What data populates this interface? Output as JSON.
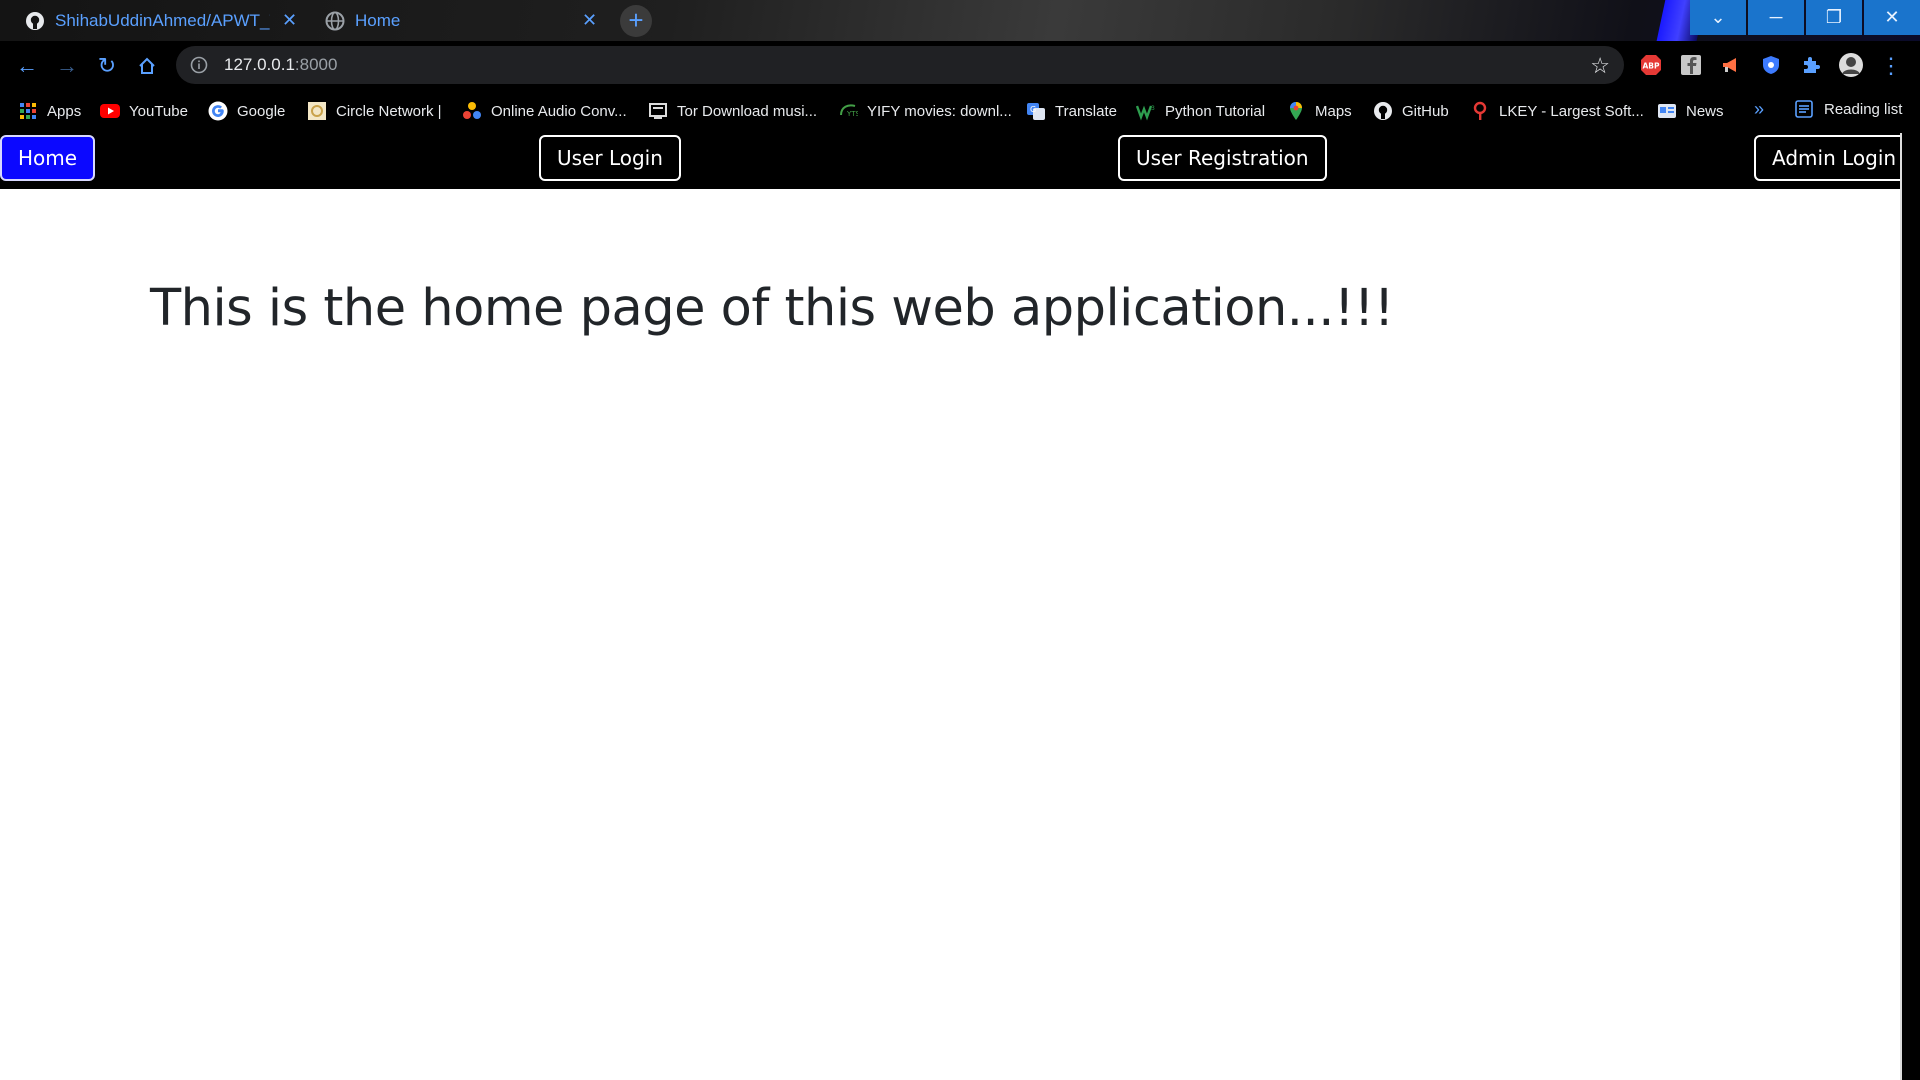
{
  "browser": {
    "tabs": [
      {
        "title": "ShihabUddinAhmed/APWT_TASK",
        "icon": "github-icon"
      },
      {
        "title": "Home",
        "icon": "globe-icon"
      }
    ],
    "address": {
      "host": "127.0.0.1",
      "port": ":8000"
    },
    "bookmarks": [
      {
        "label": "Apps",
        "icon": "apps-grid-icon"
      },
      {
        "label": "YouTube",
        "icon": "youtube-icon"
      },
      {
        "label": "Google",
        "icon": "google-icon"
      },
      {
        "label": "Circle Network |",
        "icon": "circle-network-icon"
      },
      {
        "label": "Online Audio Conv...",
        "icon": "audio-converter-icon"
      },
      {
        "label": "Tor Download musi...",
        "icon": "tor-icon"
      },
      {
        "label": "YIFY movies: downl...",
        "icon": "yify-icon"
      },
      {
        "label": "Translate",
        "icon": "translate-icon"
      },
      {
        "label": "Python Tutorial",
        "icon": "w3schools-icon"
      },
      {
        "label": "Maps",
        "icon": "maps-pin-icon"
      },
      {
        "label": "GitHub",
        "icon": "github-icon"
      },
      {
        "label": "LKEY - Largest Soft...",
        "icon": "lkey-icon"
      },
      {
        "label": "News",
        "icon": "news-icon"
      }
    ],
    "more_bookmarks": "»",
    "reading_list": "Reading list",
    "colors": {
      "accent": "#5aa0ff",
      "window_controls": "#1a74cc"
    }
  },
  "page": {
    "nav": {
      "home": "Home",
      "user_login": "User Login",
      "user_registration": "User Registration",
      "admin_login": "Admin Login"
    },
    "heading": "This is the home page of this web application...!!!",
    "colors": {
      "navbar": "#000000",
      "active_button": "#0b08ff",
      "heading": "#212529"
    }
  }
}
